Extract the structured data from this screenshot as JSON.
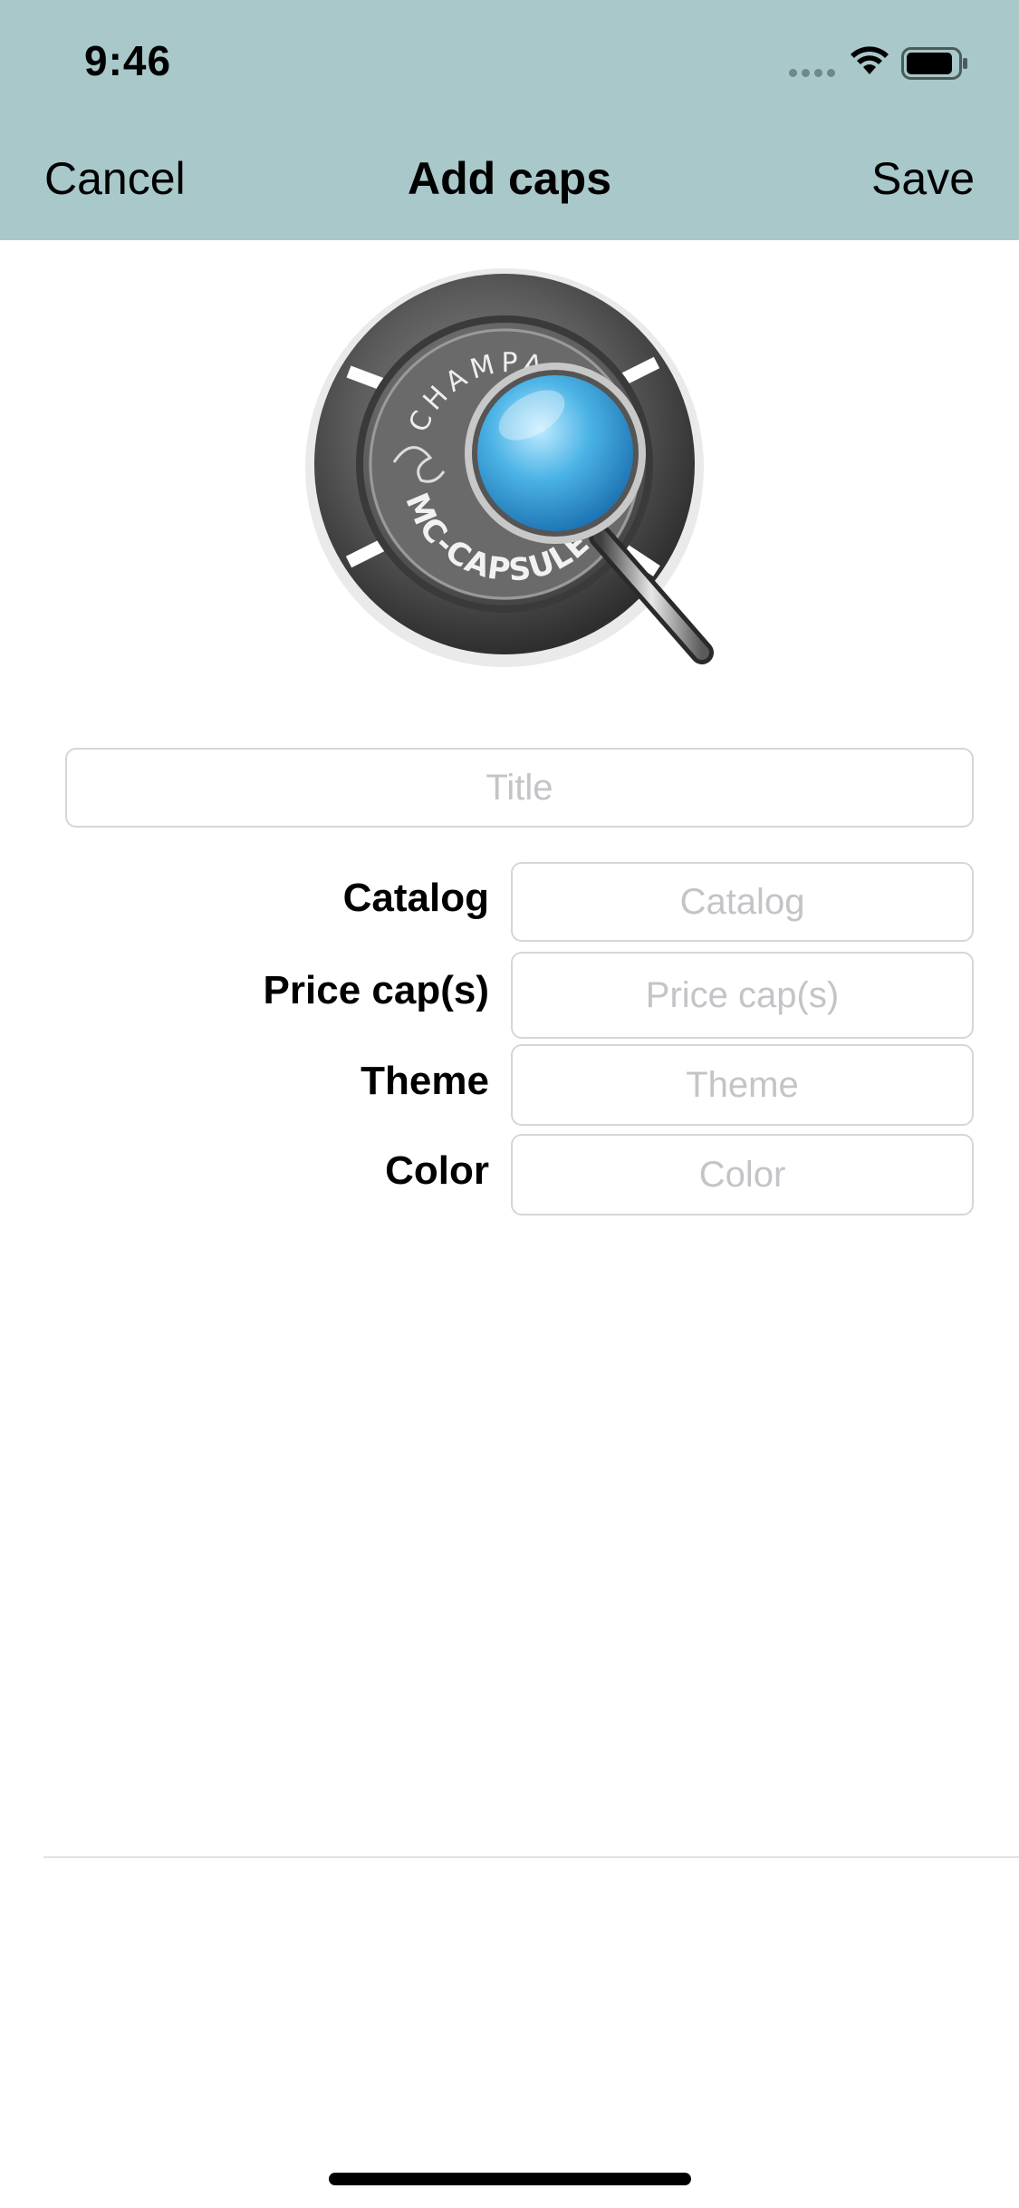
{
  "status_bar": {
    "time": "9:46"
  },
  "nav": {
    "cancel_label": "Cancel",
    "title": "Add caps",
    "save_label": "Save"
  },
  "cap_image": {
    "top_text": "CHAMPAGNE",
    "bottom_text": "MC-CAPSULE"
  },
  "form": {
    "title_placeholder": "Title",
    "fields": [
      {
        "label": "Catalog",
        "placeholder": "Catalog"
      },
      {
        "label": "Price cap(s)",
        "placeholder": "Price cap(s)"
      },
      {
        "label": "Theme",
        "placeholder": "Theme"
      },
      {
        "label": "Color",
        "placeholder": "Color"
      }
    ]
  },
  "colors": {
    "header_bg": "#a8c8ca",
    "field_border": "#d6d6d6",
    "placeholder": "#c4c4c8"
  }
}
